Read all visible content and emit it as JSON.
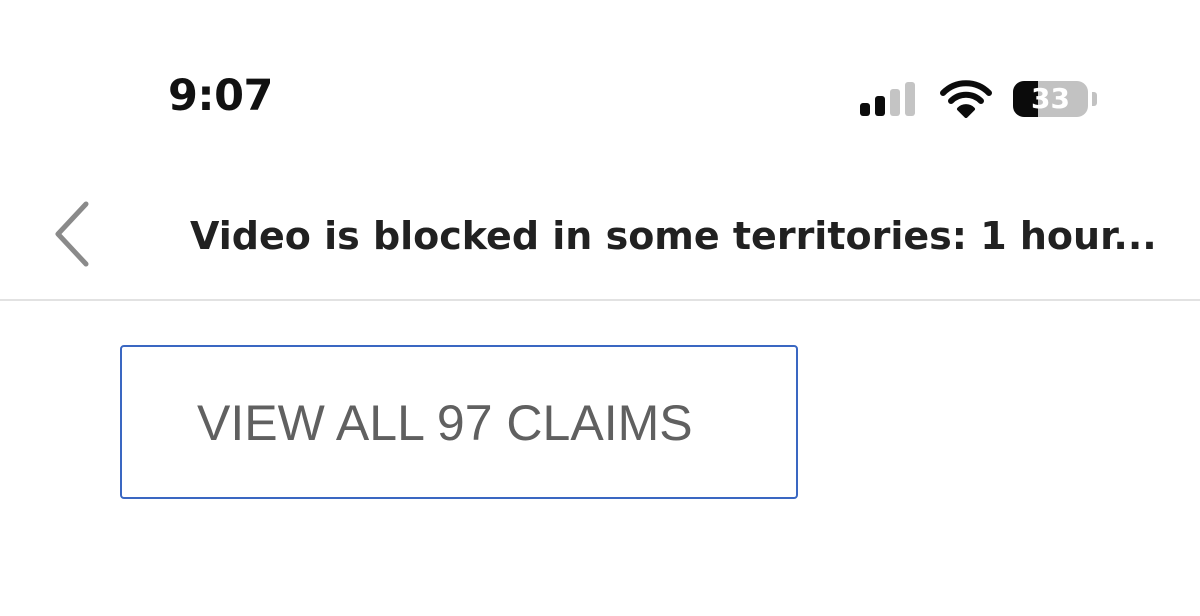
{
  "status_bar": {
    "time": "9:07",
    "signal_bars_active": 2,
    "signal_bars_total": 4,
    "wifi_icon": "wifi-icon",
    "battery": {
      "level_text": "33",
      "level_fraction": 0.33
    }
  },
  "nav": {
    "back_icon": "chevron-left-icon",
    "title": "Video is blocked in some territories: 1 hour..."
  },
  "main": {
    "view_claims_label": "VIEW ALL 97 CLAIMS"
  },
  "colors": {
    "button_border": "#3a67c2",
    "button_text": "#606060",
    "title_text": "#212121",
    "divider": "#e2e2e2",
    "back_chevron": "#8a8a8a"
  }
}
